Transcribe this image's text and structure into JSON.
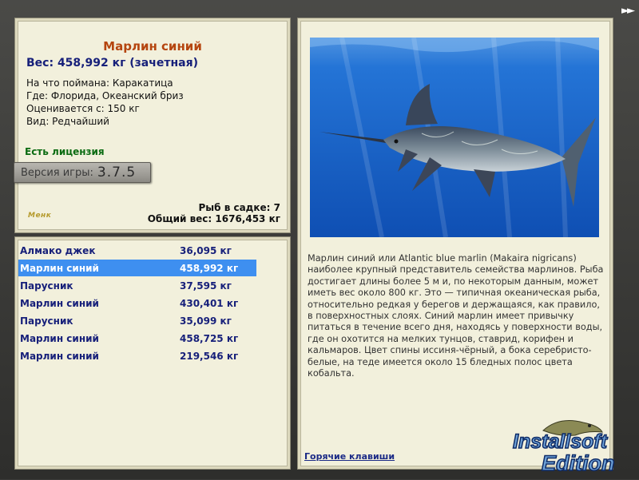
{
  "window": {
    "nav_arrow": "►►"
  },
  "info": {
    "fish_name": "Марлин синий",
    "weight_line": "Вес: 458,992 кг (зачетная)",
    "bait": "На что поймана: Каракатица",
    "location": "Где: Флорида, Океанский бриз",
    "valued_from": "Оценивается с: 150 кг",
    "rarity": "Вид: Редчайший",
    "license": "Есть лицензия",
    "version_label": "Версия игры:",
    "version_value": "3.7.5",
    "signature": "Менк",
    "fish_in_net": "Рыб в садке: 7",
    "total_weight": "Общий вес: 1676,453 кг"
  },
  "catch_list": [
    {
      "name": "Алмако джек",
      "weight": "36,095 кг",
      "selected": false
    },
    {
      "name": "Марлин синий",
      "weight": "458,992 кг",
      "selected": true
    },
    {
      "name": "Парусник",
      "weight": "37,595 кг",
      "selected": false
    },
    {
      "name": "Марлин синий",
      "weight": "430,401 кг",
      "selected": false
    },
    {
      "name": "Парусник",
      "weight": "35,099 кг",
      "selected": false
    },
    {
      "name": "Марлин синий",
      "weight": "458,725 кг",
      "selected": false
    },
    {
      "name": "Марлин синий",
      "weight": "219,546 кг",
      "selected": false
    }
  ],
  "detail": {
    "description": "Марлин синий или Atlantic blue marlin (Makaira nigricans) наиболее крупный представитель семейства марлинов. Рыба достигает длины более 5 м и, по некоторым данным, может иметь вес около 800 кг. Это — типичная океаническая рыба, относительно редкая у берегов и держащаяся, как правило, в поверхностных слоях. Синий марлин имеет привычку питаться в течение всего дня, находясь у поверхности воды, где он охотится на мелких тунцов, ставрид, корифен и кальмаров. Цвет спины иссиня-чёрный, а бока серебристо-белые, на теде имеется около 15 бледных полос цвета кобальта.",
    "hotkeys_link": "Горячие клавиши"
  },
  "watermark": {
    "line1": "Installsoft",
    "line2": "Edition"
  },
  "colors": {
    "title": "#b5450f",
    "weight": "#17207a",
    "license": "#0b6b12",
    "selection": "#3e8ff0",
    "panel_bg": "#f2f0dc",
    "water": "#1d63c4"
  }
}
